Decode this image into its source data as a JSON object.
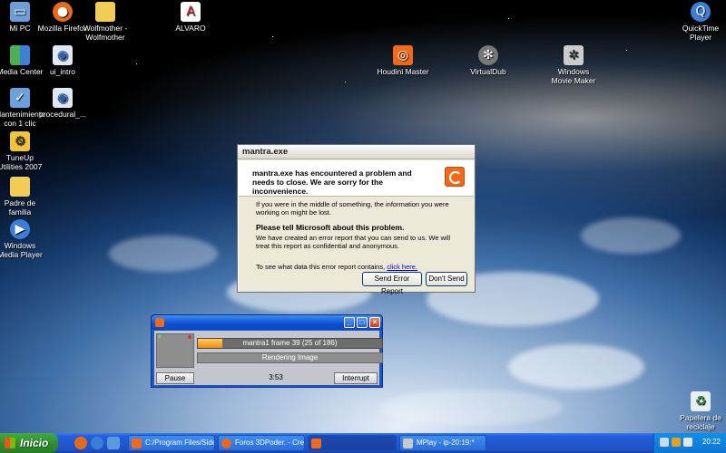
{
  "desktop": {
    "icons": [
      {
        "label": "Mi PC",
        "icon": "my-computer-icon"
      },
      {
        "label": "Mozilla Firefox",
        "icon": "firefox-icon"
      },
      {
        "label": "Wolfmother -\nWolfmother",
        "icon": "folder-icon"
      },
      {
        "label": "ALVARO",
        "icon": "pdf-document-icon"
      },
      {
        "label": "QuickTime\nPlayer",
        "icon": "quicktime-icon"
      },
      {
        "label": "Media Center",
        "icon": "media-center-icon"
      },
      {
        "label": "ui_intro",
        "icon": "movie-file-icon"
      },
      {
        "label": "Houdini Master",
        "icon": "houdini-icon"
      },
      {
        "label": "VirtualDub",
        "icon": "virtualdub-icon"
      },
      {
        "label": "Windows\nMovie Maker",
        "icon": "movie-maker-icon"
      },
      {
        "label": "Mantenimiento\ncon 1 clic",
        "icon": "maintenance-icon"
      },
      {
        "label": "procedural_...",
        "icon": "movie-file-icon"
      },
      {
        "label": "TuneUp\nUtilities 2007",
        "icon": "tuneup-icon"
      },
      {
        "label": "Padre de\nfamilia",
        "icon": "folder-icon"
      },
      {
        "label": "Windows\nMedia Player",
        "icon": "media-player-icon"
      },
      {
        "label": "Papelera de\nreciclaje",
        "icon": "recycle-bin-icon"
      }
    ]
  },
  "error_dialog": {
    "title": "mantra.exe",
    "headline": "mantra.exe has encountered a problem and needs to close.  We are sorry for the inconvenience.",
    "info": "If you were in the middle of something, the information you were working on might be lost.",
    "report_heading": "Please tell Microsoft about this problem.",
    "report_text": "We have created an error report that you can send to us.  We will treat this report as confidential and anonymous.",
    "see_data_text": "To see what data this error report contains, ",
    "click_here": "click here.",
    "send_button": "Send Error Report",
    "dont_send_button": "Don't Send"
  },
  "render_window": {
    "progress_label": "mantra1 frame 39 (25 of 186)",
    "progress_fraction": 0.134,
    "status": "Rendering Image",
    "pause_button": "Pause",
    "elapsed": "3:53",
    "interrupt_button": "Interrupt"
  },
  "taskbar": {
    "start_label": "Inicio",
    "tasks": [
      {
        "label": "C:/Program Files/Side...",
        "active": false
      },
      {
        "label": "Foros 3DPoder. - Cre...",
        "active": false
      },
      {
        "label": "",
        "active": true
      },
      {
        "label": "MPlay - ip-20:19:*",
        "active": false
      }
    ],
    "clock": "20:22"
  }
}
